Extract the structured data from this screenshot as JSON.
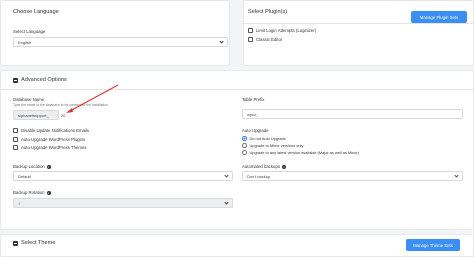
{
  "language": {
    "title": "Choose Language",
    "select_label": "Select Language",
    "selected": "English"
  },
  "plugins": {
    "title": "Select Plugin(s)",
    "items": [
      {
        "label": "Limit Login Attempts (Loginizer)"
      },
      {
        "label": "Classic Editor"
      }
    ],
    "manage_button": "Manage Plugin Sets"
  },
  "advanced": {
    "title": "Advanced Options",
    "db_name": {
      "label": "Database Name",
      "help": "Type the name of the database to be created for the installation",
      "prefix": "siphanetsupport_",
      "value": "20"
    },
    "table_prefix": {
      "label": "Table Prefix",
      "value": "wpco_"
    },
    "checkboxes": [
      {
        "label": "Disable Update Notifications Emails"
      },
      {
        "label": "Auto Upgrade WordPress Plugins"
      },
      {
        "label": "Auto Upgrade WordPress Themes"
      }
    ],
    "auto_upgrade": {
      "label": "Auto Upgrade",
      "options": [
        {
          "label": "Do not Auto Upgrade",
          "selected": true
        },
        {
          "label": "Upgrade to Minor versions only",
          "selected": false
        },
        {
          "label": "Upgrade to any latest version available (Major as well as Minor)",
          "selected": false
        }
      ]
    },
    "backup_location": {
      "label": "Backup Location",
      "selected": "Default"
    },
    "automated_backups": {
      "label": "Automated backups",
      "selected": "Don't backup"
    },
    "backup_rotation": {
      "label": "Backup Rotation",
      "selected": "4"
    }
  },
  "theme": {
    "title": "Select Theme",
    "manage_button": "Manage Theme Sets"
  },
  "colors": {
    "accent": "#3b8ef3",
    "annotation_arrow": "#e0312b"
  }
}
